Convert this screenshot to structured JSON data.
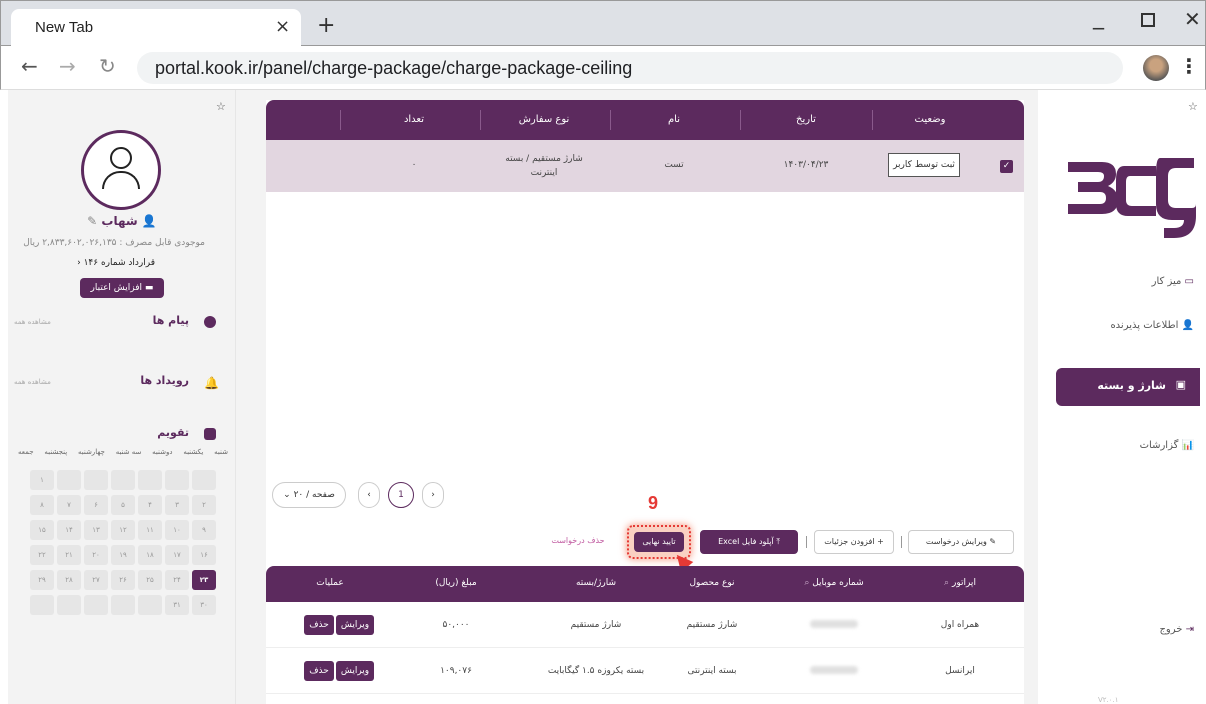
{
  "browser": {
    "tab_title": "New Tab",
    "url": "portal.kook.ir/panel/charge-package/charge-package-ceiling"
  },
  "left": {
    "username": "شهاب",
    "balance": "موجودی قابل مصرف : ۲,۸۳۳,۶۰۲,۰۲۶,۱۳۵ ریال",
    "contract": "قرارداد شماره ۱۴۶",
    "credit_button": "افزایش اعتبار",
    "messages_title": "پیام ها",
    "messages_seeall": "مشاهده همه",
    "events_title": "رویداد ها",
    "events_seeall": "مشاهده همه",
    "calendar_title": "تقویم",
    "weekdays": [
      "شنبه",
      "یکشنبه",
      "دوشنبه",
      "سه شنبه",
      "چهارشنبه",
      "پنجشنبه",
      "جمعه"
    ],
    "calendar_days": [
      "",
      "",
      "",
      "",
      "",
      "",
      "۱",
      "۲",
      "۳",
      "۴",
      "۵",
      "۶",
      "۷",
      "۸",
      "۹",
      "۱۰",
      "۱۱",
      "۱۲",
      "۱۳",
      "۱۴",
      "۱۵",
      "۱۶",
      "۱۷",
      "۱۸",
      "۱۹",
      "۲۰",
      "۲۱",
      "۲۲",
      "۲۳",
      "۲۴",
      "۲۵",
      "۲۶",
      "۲۷",
      "۲۸",
      "۲۹",
      "۳۰",
      "۳۱",
      "",
      "",
      "",
      "",
      ""
    ],
    "today": "۲۳"
  },
  "orders_table": {
    "headers": [
      "وضعیت",
      "تاریخ",
      "نام",
      "نوع سفارش",
      "تعداد"
    ],
    "row": {
      "status": "ثبت توسط کاربر",
      "date": "۱۴۰۳/۰۴/۲۳",
      "name": "تست",
      "order_type": "شارژ مستقیم / بسته اینترنت",
      "count": "۰"
    }
  },
  "pagination": {
    "page_size": "۲۰ / صفحه",
    "current_page": "1",
    "prev": "‹",
    "next": "›"
  },
  "toolbar": {
    "edit_request": "ویرایش درخواست",
    "add_details": "افزودن جزئیات",
    "upload_excel": "آپلود فایل Excel",
    "final_confirm": "تایید نهایی",
    "delete_request": "حذف درخواست"
  },
  "annotation": {
    "step": "9"
  },
  "details_table": {
    "headers": [
      "اپراتور",
      "شماره موبایل",
      "نوع محصول",
      "شارژ/بسته",
      "مبلغ (ریال)",
      "عملیات"
    ],
    "rows": [
      {
        "operator": "همراه اول",
        "product_type": "شارژ مستقیم",
        "package": "شارژ مستقیم",
        "amount": "۵۰,۰۰۰",
        "edit": "ویرایش",
        "delete": "حذف"
      },
      {
        "operator": "ایرانسل",
        "product_type": "بسته اینترنتی",
        "package": "بسته یکروزه ۱.۵ گیگابایت",
        "amount": "۱۰۹,۰۷۶",
        "edit": "ویرایش",
        "delete": "حذف"
      }
    ]
  },
  "nav": {
    "dashboard": "میز کار",
    "acceptor_info": "اطلاعات پذیرنده",
    "charge_package": "شارژ و بسته",
    "reports": "گزارشات",
    "logout": "خروج",
    "version": "V۲.۰.۱"
  },
  "colors": {
    "primary": "#5c2a5e",
    "selected_row": "#e2d6e0",
    "annotation": "#e53935"
  }
}
